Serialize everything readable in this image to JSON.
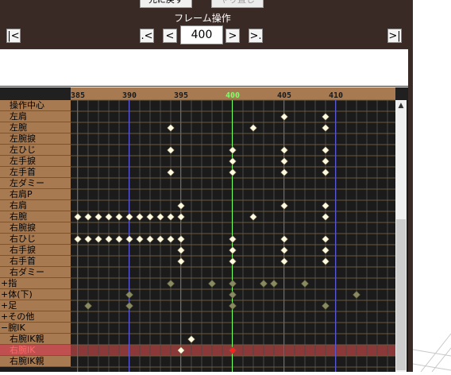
{
  "toolbar": {
    "reset_label": "元に戻す",
    "redo_label": "やり直し",
    "frame_title": "フレーム操作",
    "first_label": "|<",
    "prev_key_label": ".<",
    "prev_label": "<",
    "frame_value": "400",
    "next_label": ">",
    "next_key_label": ">.",
    "last_label": ">|"
  },
  "ruler": {
    "tick_labels": [
      "385",
      "390",
      "395",
      "400",
      "405",
      "410"
    ],
    "current_frame": "400",
    "current_color": "#7dff6a"
  },
  "bones": [
    {
      "label": "操作中心",
      "indent": true,
      "style": "normal"
    },
    {
      "label": "左肩",
      "indent": true,
      "style": "normal"
    },
    {
      "label": "左腕",
      "indent": true,
      "style": "normal"
    },
    {
      "label": "左腕捩",
      "indent": true,
      "style": "normal"
    },
    {
      "label": "左ひじ",
      "indent": true,
      "style": "normal"
    },
    {
      "label": "左手捩",
      "indent": true,
      "style": "normal"
    },
    {
      "label": "左手首",
      "indent": true,
      "style": "normal"
    },
    {
      "label": "左ダミー",
      "indent": true,
      "style": "normal"
    },
    {
      "label": "右肩P",
      "indent": true,
      "style": "normal"
    },
    {
      "label": "右肩",
      "indent": true,
      "style": "normal"
    },
    {
      "label": "右腕",
      "indent": true,
      "style": "normal"
    },
    {
      "label": "右腕捩",
      "indent": true,
      "style": "normal"
    },
    {
      "label": "右ひじ",
      "indent": true,
      "style": "normal"
    },
    {
      "label": "右手捩",
      "indent": true,
      "style": "normal"
    },
    {
      "label": "右手首",
      "indent": true,
      "style": "normal"
    },
    {
      "label": "右ダミー",
      "indent": true,
      "style": "normal"
    },
    {
      "label": "+指",
      "indent": false,
      "style": "group"
    },
    {
      "label": "+体(下)",
      "indent": false,
      "style": "group"
    },
    {
      "label": "+足",
      "indent": false,
      "style": "group"
    },
    {
      "label": "+その他",
      "indent": false,
      "style": "group"
    },
    {
      "label": "−腕IK",
      "indent": false,
      "style": "group"
    },
    {
      "label": "右腕IK親",
      "indent": true,
      "style": "normal"
    },
    {
      "label": "右腕IK",
      "indent": true,
      "style": "selected"
    },
    {
      "label": "右腕IK親",
      "indent": true,
      "style": "normal"
    }
  ],
  "keyframes": [
    {
      "row": 1,
      "frames": [
        405,
        409
      ]
    },
    {
      "row": 2,
      "frames": [
        394,
        402,
        409
      ]
    },
    {
      "row": 4,
      "frames": [
        394,
        400,
        405,
        409
      ]
    },
    {
      "row": 5,
      "frames": [
        400,
        405,
        409
      ]
    },
    {
      "row": 6,
      "frames": [
        394,
        400,
        405,
        409
      ]
    },
    {
      "row": 9,
      "frames": [
        395,
        405,
        409
      ]
    },
    {
      "row": 10,
      "frames": [
        385,
        386,
        387,
        388,
        389,
        390,
        391,
        392,
        393,
        394,
        395,
        402,
        409
      ]
    },
    {
      "row": 12,
      "frames": [
        385,
        386,
        387,
        388,
        389,
        390,
        391,
        392,
        393,
        394,
        395,
        400,
        405,
        409
      ]
    },
    {
      "row": 13,
      "frames": [
        395,
        400,
        405,
        409
      ]
    },
    {
      "row": 14,
      "frames": [
        395,
        400,
        405,
        409
      ]
    },
    {
      "row": 16,
      "frames": [
        394,
        398,
        400,
        403,
        404,
        407
      ],
      "group": true
    },
    {
      "row": 17,
      "frames": [
        390,
        400,
        412
      ],
      "group": true
    },
    {
      "row": 18,
      "frames": [
        386,
        390,
        400,
        409
      ],
      "group": true
    },
    {
      "row": 21,
      "frames": [
        396
      ]
    },
    {
      "row": 22,
      "frames": [
        395
      ]
    },
    {
      "row": 22,
      "frames": [
        400
      ],
      "selected": true
    }
  ],
  "colors": {
    "bone_label_bg": "#a87a52",
    "selected_row_bg": "#8a3838",
    "selected_label_bg": "#c05050",
    "selected_label_text": "#ff6a6a",
    "key_color": "#fffbe0",
    "group_key_color": "#8a8a60",
    "selected_key_color": "#ff2020"
  },
  "icons": {
    "scroll_up": "▲"
  }
}
